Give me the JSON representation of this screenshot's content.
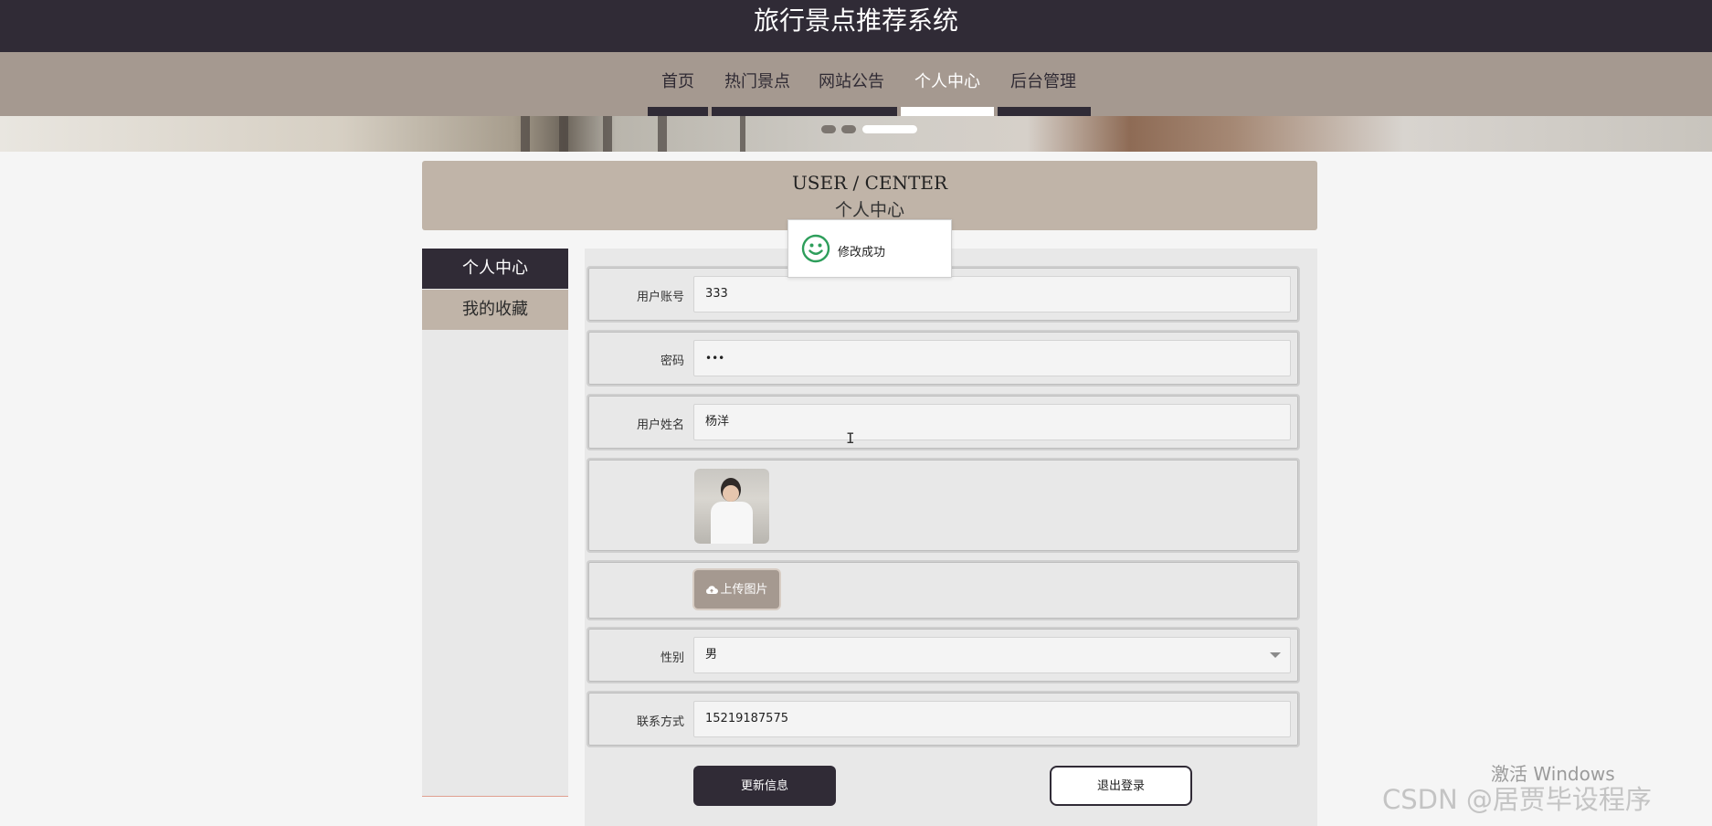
{
  "app": {
    "site_title": "旅行景点推荐系统"
  },
  "nav": {
    "items": [
      {
        "label": "首页"
      },
      {
        "label": "热门景点"
      },
      {
        "label": "网站公告"
      },
      {
        "label": "个人中心",
        "active": true
      },
      {
        "label": "后台管理"
      }
    ]
  },
  "page_head": {
    "en": "USER / CENTER",
    "zh": "个人中心"
  },
  "sidebar": {
    "items": [
      {
        "label": "个人中心",
        "active": true
      },
      {
        "label": "我的收藏"
      }
    ]
  },
  "form": {
    "account_label": "用户账号",
    "account_value": "333",
    "password_label": "密码",
    "password_value": "•••",
    "name_label": "用户姓名",
    "name_value": "杨洋",
    "upload_label": "上传图片",
    "gender_label": "性别",
    "gender_value": "男",
    "contact_label": "联系方式",
    "contact_value": "15219187575",
    "update_button": "更新信息",
    "logout_button": "退出登录"
  },
  "toast": {
    "message": "修改成功"
  },
  "watermark": {
    "windows": "激活 Windows",
    "csdn": "CSDN @居贾毕设程序"
  },
  "colors": {
    "header_bg": "#302b36",
    "nav_bg": "#a59990",
    "accent_beige": "#c0b4a8",
    "toast_icon": "#2e9e5b"
  }
}
